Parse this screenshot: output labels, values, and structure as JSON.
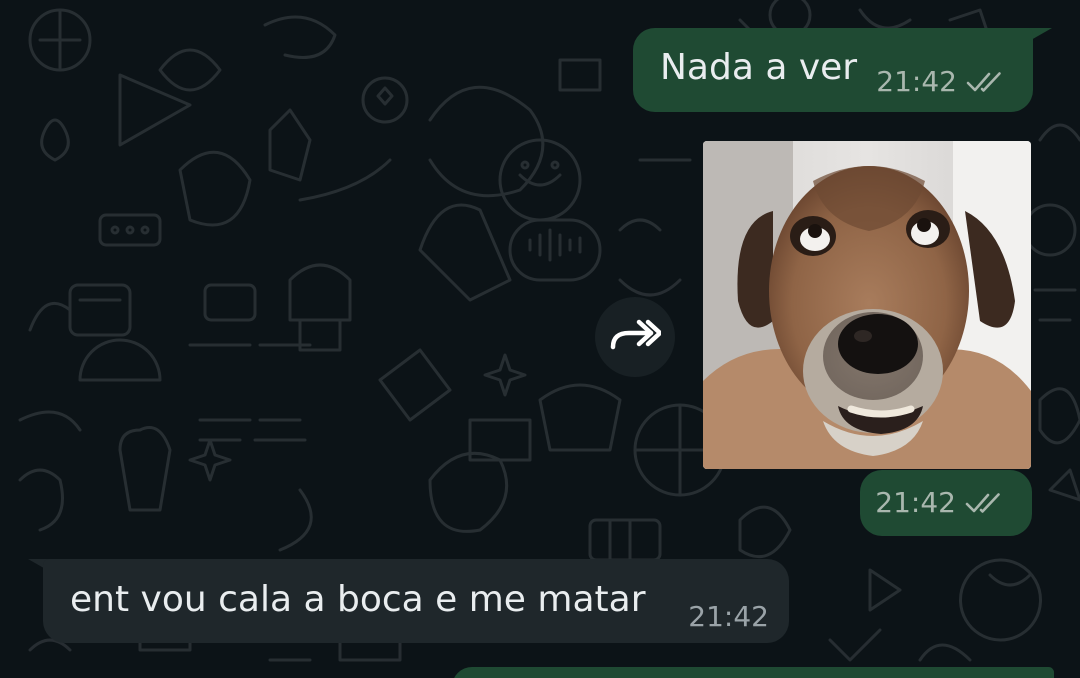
{
  "messages": [
    {
      "direction": "outgoing",
      "text": "Nada a ver",
      "time": "21:42",
      "status_icon": "double-check-icon"
    },
    {
      "direction": "outgoing",
      "type": "image",
      "image_description_icon": "dog-sticker-image",
      "time": "21:42",
      "status_icon": "double-check-icon"
    },
    {
      "direction": "incoming",
      "text": "ent vou cala a boca e me matar",
      "time": "21:42"
    }
  ],
  "actions": {
    "forward_icon": "forward-icon"
  },
  "colors": {
    "background": "#0c1317",
    "outgoing_bubble": "#1f4a33",
    "incoming_bubble": "#1f272b",
    "text": "#e9edef",
    "meta_text": "#a9b7ae"
  }
}
